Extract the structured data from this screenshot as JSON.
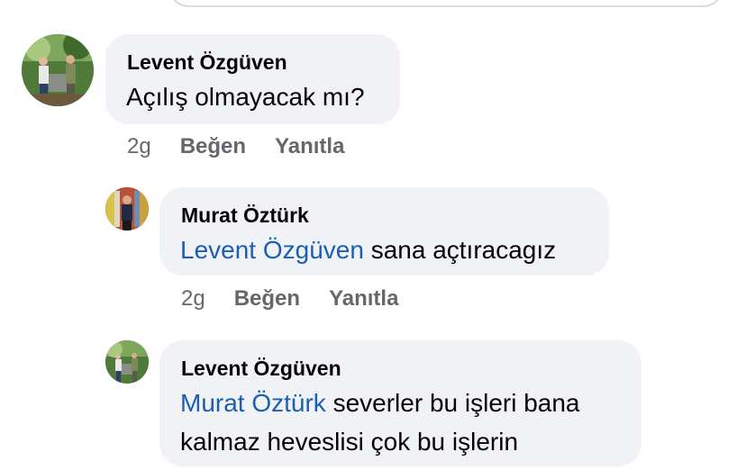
{
  "comments": [
    {
      "author": "Levent Özgüven",
      "text": "Açılış olmayacak mı?",
      "time": "2g",
      "like_label": "Beğen",
      "reply_label": "Yanıtla"
    },
    {
      "author": "Murat Öztürk",
      "mention": "Levent Özgüven",
      "text": " sana açtıracagız",
      "time": "2g",
      "like_label": "Beğen",
      "reply_label": "Yanıtla"
    },
    {
      "author": "Levent Özgüven",
      "mention": "Murat Öztürk",
      "text_line1": " severler bu işleri bana",
      "text_line2": "kalmaz heveslisi çok bu işlerin"
    }
  ]
}
